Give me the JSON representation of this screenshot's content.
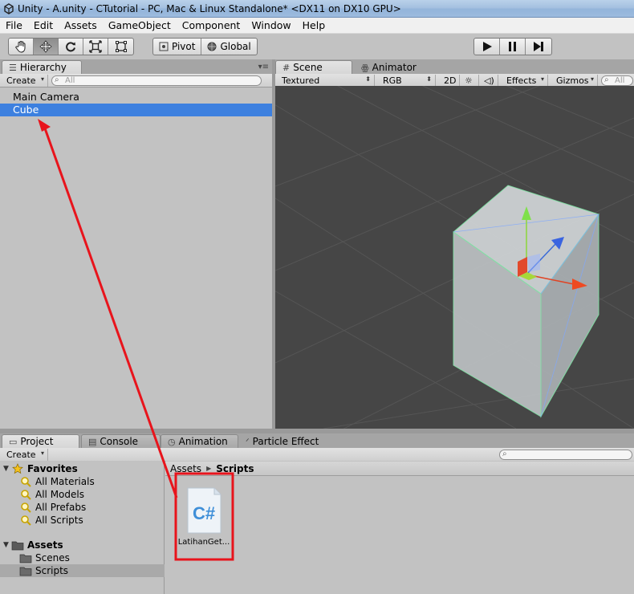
{
  "window": {
    "title": "Unity - A.unity - CTutorial - PC, Mac & Linux Standalone* <DX11 on DX10 GPU>"
  },
  "menu": [
    "File",
    "Edit",
    "Assets",
    "GameObject",
    "Component",
    "Window",
    "Help"
  ],
  "toolbar": {
    "transform_tools": [
      "hand-icon",
      "move-icon",
      "rotate-icon",
      "scale-icon",
      "rect-icon"
    ],
    "pivot_label": "Pivot",
    "global_label": "Global",
    "playback": [
      "play-icon",
      "pause-icon",
      "step-icon"
    ]
  },
  "hierarchy": {
    "tab": "Hierarchy",
    "create_label": "Create",
    "search_placeholder": "All",
    "items": [
      {
        "label": "Main Camera",
        "selected": false
      },
      {
        "label": "Cube",
        "selected": true
      }
    ]
  },
  "scene": {
    "tabs": [
      {
        "label": "Scene",
        "icon": "hash-icon"
      },
      {
        "label": "Animator",
        "icon": "animator-icon"
      }
    ],
    "shading_mode": "Textured",
    "render_mode": "RGB",
    "mode_2d": "2D",
    "effects_label": "Effects",
    "gizmos_label": "Gizmos",
    "search_placeholder": "All",
    "background_color": "#464646"
  },
  "project": {
    "tabs": [
      {
        "label": "Project",
        "icon": "folder-icon"
      },
      {
        "label": "Console",
        "icon": "console-icon"
      },
      {
        "label": "Animation",
        "icon": "clock-icon"
      },
      {
        "label": "Particle Effect",
        "icon": "particle-icon"
      }
    ],
    "create_label": "Create",
    "favorites_label": "Favorites",
    "favorites": [
      "All Materials",
      "All Models",
      "All Prefabs",
      "All Scripts"
    ],
    "assets_label": "Assets",
    "folders": [
      "Scenes",
      "Scripts"
    ],
    "breadcrumb": [
      "Assets",
      "Scripts"
    ],
    "files": [
      {
        "label": "LatihanGet...",
        "glyph": "C#",
        "type": "csharp-script"
      }
    ]
  },
  "annotation": {
    "color": "#e8141c"
  }
}
